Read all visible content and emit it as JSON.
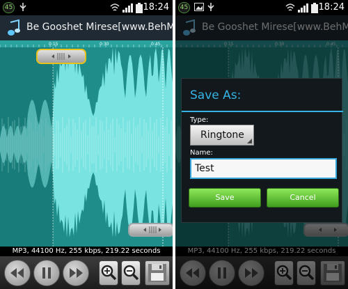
{
  "status_bar": {
    "badge": "45",
    "time": "18:24"
  },
  "app": {
    "title": "Be Gooshet Mirese[www.BehMus"
  },
  "timeline": {
    "ticks": [
      "0:15",
      "0:30",
      "0:45"
    ]
  },
  "audio_info": "MP3, 44100 Hz, 255 kbps, 219.22 seconds",
  "icons": {
    "app": "music-note-icon",
    "rewind": "rewind-icon",
    "play_pause": "pause-icon",
    "forward": "forward-icon",
    "zoom_in": "zoom-in-icon",
    "zoom_out": "zoom-out-icon",
    "save": "floppy-disk-icon",
    "wifi": "wifi-icon",
    "signal": "signal-icon",
    "battery": "battery-icon"
  },
  "dialog": {
    "title": "Save As:",
    "type_label": "Type:",
    "type_value": "Ringtone",
    "name_label": "Name:",
    "name_value": "Test",
    "save_label": "Save",
    "cancel_label": "Cancel"
  },
  "colors": {
    "waveform_bg": "#1f8e8a",
    "waveform_fg": "#7ee8e6",
    "accent": "#35b5e5",
    "handle_border": "#e8c218",
    "button_green": "#5cc22e"
  }
}
